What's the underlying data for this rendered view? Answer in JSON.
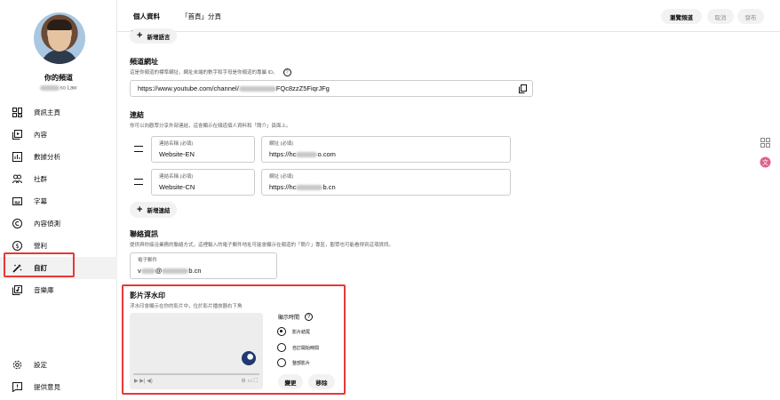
{
  "sidebar": {
    "channel_title": "你的頻道",
    "channel_handle": "so Law",
    "items": [
      {
        "label": "資訊主頁",
        "icon": "dashboard-icon"
      },
      {
        "label": "內容",
        "icon": "content-icon"
      },
      {
        "label": "數據分析",
        "icon": "analytics-icon"
      },
      {
        "label": "社群",
        "icon": "community-icon"
      },
      {
        "label": "字幕",
        "icon": "subtitles-icon"
      },
      {
        "label": "內容偵測",
        "icon": "copyright-icon"
      },
      {
        "label": "營利",
        "icon": "monetization-icon"
      },
      {
        "label": "自訂",
        "icon": "customization-icon"
      },
      {
        "label": "音樂庫",
        "icon": "audio-library-icon"
      }
    ],
    "bottom": [
      {
        "label": "設定",
        "icon": "gear-icon"
      },
      {
        "label": "提供意見",
        "icon": "feedback-icon"
      }
    ]
  },
  "header": {
    "tabs": [
      "個人資料",
      "「首頁」分頁"
    ],
    "view_channel": "瀏覽頻道",
    "cancel": "取消",
    "publish": "發布"
  },
  "add_language": "新增語言",
  "channel_url": {
    "title": "頻道網址",
    "desc": "這是你頻道的標準網址，網址末端的數字和字母是你頻道的專屬 ID。",
    "value_prefix": "https://www.youtube.com/channel/",
    "value_suffix": "FQc8zzZ5FiqrJFg"
  },
  "links": {
    "title": "連結",
    "desc": "你可以向觀眾分享外部連結，這會顯示在頻道個人資料和「簡介」頁面上。",
    "name_label": "連結名稱 (必填)",
    "url_label": "網址 (必填)",
    "rows": [
      {
        "name": "Website-EN",
        "url_prefix": "https://hc",
        "url_suffix": "o.com"
      },
      {
        "name": "Website-CN",
        "url_prefix": "https://hc",
        "url_suffix": "b.cn"
      }
    ],
    "add_label": "新增連結"
  },
  "contact": {
    "title": "聯絡資訊",
    "desc": "提供與你接洽業務的聯絡方式，這裡輸入的電子郵件地址可能會顯示在頻道的「簡介」專區，觀眾也可能看得到這項資訊。",
    "email_label": "電子郵件",
    "email_prefix": "v",
    "email_mid": "@",
    "email_suffix": "b.cn"
  },
  "watermark": {
    "title": "影片浮水印",
    "desc": "浮水印會顯示在你的影片中，位於影片播放器右下角",
    "display_time_label": "顯示時間",
    "options": [
      "影片結尾",
      "自訂開始時間",
      "整部影片"
    ],
    "selected": 0,
    "change": "變更",
    "remove": "移除"
  },
  "colors": {
    "highlight": "#e53935",
    "accent_pink": "#e06090"
  }
}
